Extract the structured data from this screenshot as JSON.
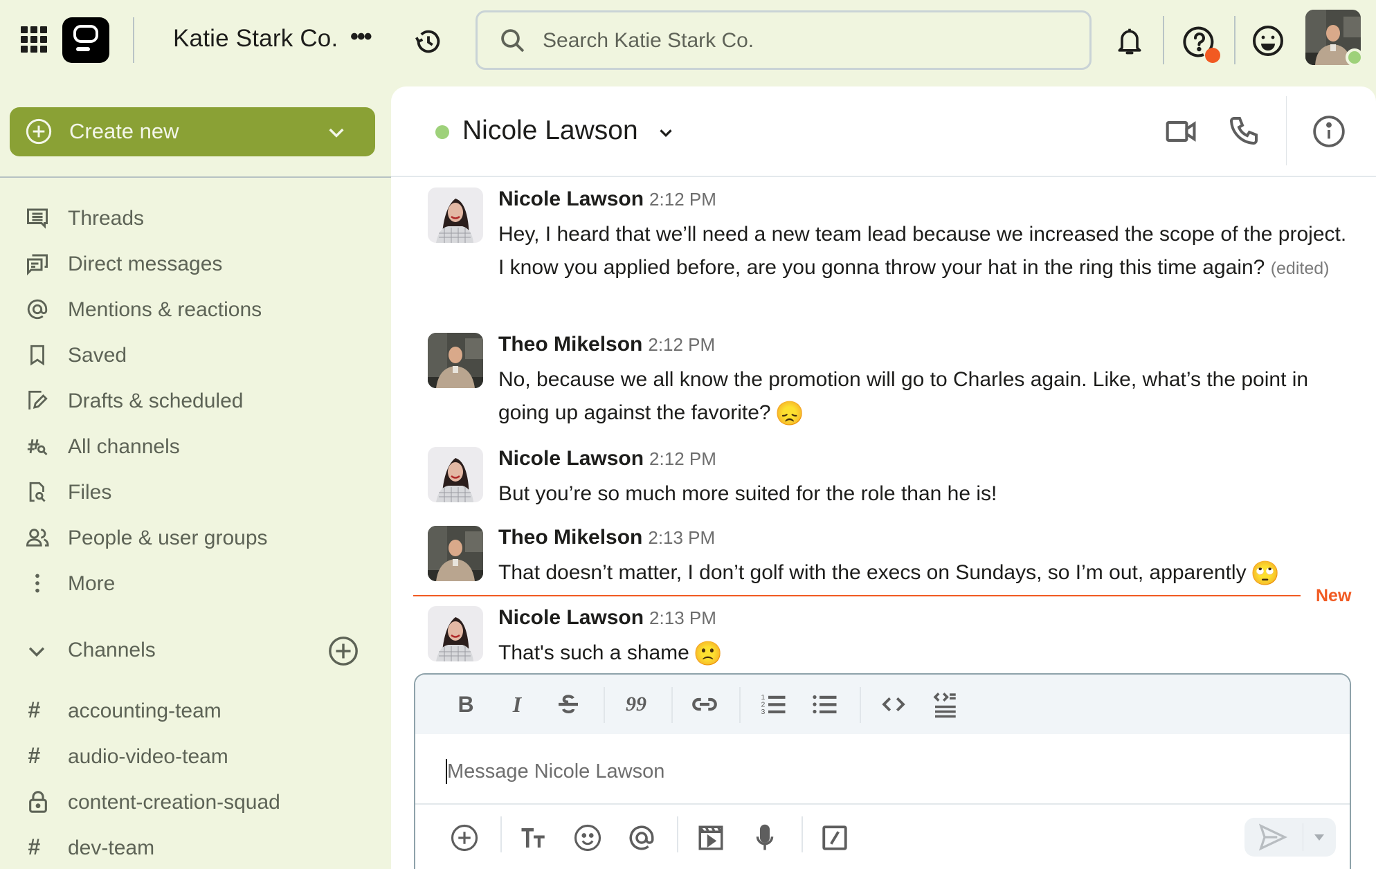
{
  "topbar": {
    "org_name": "Katie Stark Co.",
    "org_more": "•••",
    "search_placeholder": "Search Katie Stark Co.",
    "help_badge_color": "#f15a22",
    "user_status_color": "#9ed17a"
  },
  "sidebar": {
    "create_new_label": "Create new",
    "accent_color": "#8aa135",
    "nav_items": [
      {
        "label": "Threads",
        "icon": "threads-icon"
      },
      {
        "label": "Direct messages",
        "icon": "direct-messages-icon"
      },
      {
        "label": "Mentions & reactions",
        "icon": "at-icon"
      },
      {
        "label": "Saved",
        "icon": "bookmark-icon"
      },
      {
        "label": "Drafts & scheduled",
        "icon": "draft-edit-icon"
      },
      {
        "label": "All channels",
        "icon": "channel-search-icon"
      },
      {
        "label": "Files",
        "icon": "file-search-icon"
      },
      {
        "label": "People & user groups",
        "icon": "people-icon"
      },
      {
        "label": "More",
        "icon": "more-vertical-icon"
      }
    ],
    "channels_header": "Channels",
    "channels": [
      {
        "name": "accounting-team",
        "type": "public"
      },
      {
        "name": "audio-video-team",
        "type": "public"
      },
      {
        "name": "content-creation-squad",
        "type": "private"
      },
      {
        "name": "dev-team",
        "type": "public"
      }
    ]
  },
  "chat": {
    "peer_name": "Nicole Lawson",
    "peer_status": "online",
    "messages": [
      {
        "author": "Nicole Lawson",
        "time": "2:12 PM",
        "text": "Hey, I heard that we’ll need a new team lead because we increased the scope of the project. I know you applied before, are you gonna throw your hat in the ring this time again?",
        "edited": "(edited)",
        "emoji": ""
      },
      {
        "author": "Theo Mikelson",
        "time": "2:12 PM",
        "text": "No, because we all know the promotion will go to Charles again. Like, what’s the point in going up against the favorite?",
        "edited": "",
        "emoji": "😞"
      },
      {
        "author": "Nicole Lawson",
        "time": "2:12 PM",
        "text": "But you’re so much more suited for the role than he is!",
        "edited": "",
        "emoji": ""
      },
      {
        "author": "Theo Mikelson",
        "time": "2:13 PM",
        "text": "That doesn’t matter, I don’t golf with the execs on Sundays, so I’m out, apparently",
        "edited": "",
        "emoji": "🙄"
      },
      {
        "author": "Nicole Lawson",
        "time": "2:13 PM",
        "text": "That's such a shame",
        "edited": "",
        "emoji": "🙁"
      }
    ],
    "new_divider_label": "New",
    "new_divider_color": "#f15a22"
  },
  "composer": {
    "placeholder": "Message Nicole Lawson",
    "format_tools": [
      "bold",
      "italic",
      "strikethrough",
      "quote",
      "link",
      "ordered-list",
      "bulleted-list",
      "code",
      "code-block"
    ],
    "action_tools": [
      "add",
      "text-format",
      "emoji",
      "mention",
      "video-clip",
      "voice-message",
      "slash-command"
    ],
    "bold_glyph": "B",
    "italic_glyph": "I",
    "strike_glyph": "S",
    "quote_glyph": "99",
    "code_glyph": "<>",
    "format_glyph": "TT"
  }
}
